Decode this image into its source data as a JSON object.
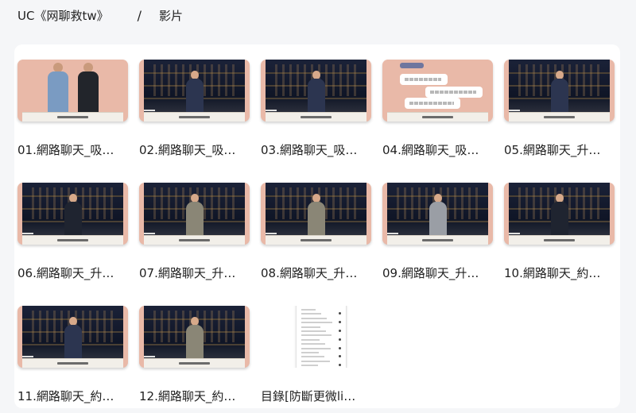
{
  "breadcrumb": {
    "root": "UC《网聊救tw》",
    "separator": "/",
    "current": "影片"
  },
  "items": [
    {
      "title": "01.網路聊天_吸…",
      "thumb": "models"
    },
    {
      "title": "02.網路聊天_吸…",
      "thumb": "presenter"
    },
    {
      "title": "03.網路聊天_吸…",
      "thumb": "presenter"
    },
    {
      "title": "04.網路聊天_吸…",
      "thumb": "chat"
    },
    {
      "title": "05.網路聊天_升…",
      "thumb": "presenter"
    },
    {
      "title": "06.網路聊天_升…",
      "thumb": "presenter-dark"
    },
    {
      "title": "07.網路聊天_升…",
      "thumb": "presenter-grey"
    },
    {
      "title": "08.網路聊天_升…",
      "thumb": "presenter-grey"
    },
    {
      "title": "09.網路聊天_升…",
      "thumb": "presenter-light"
    },
    {
      "title": "10.網路聊天_約…",
      "thumb": "presenter-dark"
    },
    {
      "title": "11.網路聊天_約…",
      "thumb": "presenter"
    },
    {
      "title": "12.網路聊天_約…",
      "thumb": "presenter-grey"
    },
    {
      "title": "目錄[防斷更微li…",
      "thumb": "document"
    }
  ]
}
